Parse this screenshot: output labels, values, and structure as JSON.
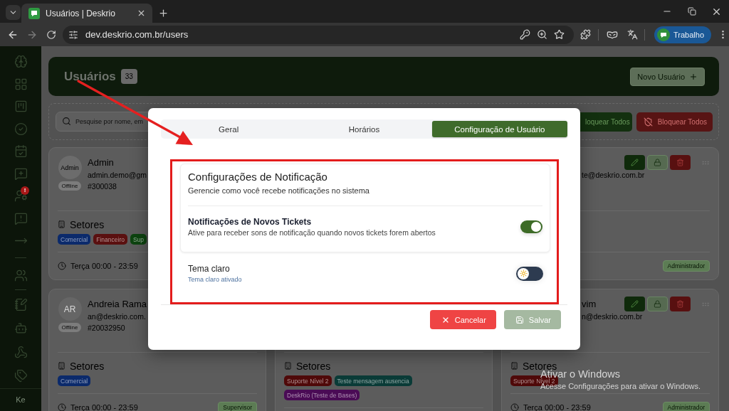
{
  "browser": {
    "tabs": [
      {
        "title": "Usuários | Deskrio",
        "selected": true
      }
    ],
    "url": "dev.deskrio.com.br/users",
    "profile_name": "Trabalho"
  },
  "sidebar": {
    "alert_badge": "!",
    "user_initials": "Ke"
  },
  "header": {
    "title": "Usuários",
    "count": "33",
    "new_user_button": "Novo Usuário"
  },
  "filters": {
    "search_placeholder": "Pesquise por nome, em",
    "buttons": [
      {
        "label": "loquear Todos",
        "kind": "unblock"
      },
      {
        "label": "Bloquear Todos",
        "kind": "block"
      }
    ]
  },
  "user_cards": [
    {
      "avatar": {
        "kind": "image",
        "text": "Admin"
      },
      "status": "Offline",
      "name": "Admin",
      "email": "admin.demo@gm",
      "code": "#300038",
      "sectors_title": "Setores",
      "sectors": [
        {
          "label": "Comercial",
          "color": "#0b2a6b"
        },
        {
          "label": "Financeiro",
          "color": "#5a1010"
        },
        {
          "label": "Sup",
          "color": "#0d4410"
        }
      ],
      "schedule": "Terça 00:00 - 23:59"
    },
    {
      "actions": [
        {
          "kind": "edit"
        },
        {
          "kind": "lock"
        },
        {
          "kind": "delete"
        }
      ],
      "email": "te@deskrio.com.br",
      "role": "Administrador"
    },
    {
      "avatar": {
        "kind": "initials",
        "text": "AR"
      },
      "status": "Offline",
      "name": "Andreia Rama",
      "email": "an@deskrio.com.",
      "code": "#20032950",
      "sectors_title": "Setores",
      "sectors": [
        {
          "label": "Comercial",
          "color": "#0b2a6b"
        }
      ],
      "schedule": "Terça 00:00 - 23:59",
      "role": "Supervisor"
    },
    {
      "sectors_title": "Setores",
      "sectors": [
        {
          "label": "Suporte Nível 2",
          "color": "#4f0909"
        },
        {
          "label": "Teste mensagem ausencia",
          "color": "#0a3b37"
        },
        {
          "label": "DeskRio (Teste de Bases)",
          "color": "#4a0b55"
        }
      ]
    },
    {
      "actions": [
        {
          "kind": "edit"
        },
        {
          "kind": "lock"
        },
        {
          "kind": "delete"
        }
      ],
      "name": "vim",
      "email": "n@deskrio.com.br",
      "sectors_title": "Setores",
      "sectors": [
        {
          "label": "Suporte Nível 2",
          "color": "#4f0909"
        }
      ],
      "schedule": "Terça 00:00 - 23:59",
      "role": "Administrador"
    }
  ],
  "modal": {
    "tabs": [
      {
        "label": "Geral",
        "selected": false
      },
      {
        "label": "Horários",
        "selected": false
      },
      {
        "label": "Configuração de Usuário",
        "selected": true
      }
    ],
    "notification_card": {
      "title": "Configurações de Notificação",
      "subtitle": "Gerencie como você recebe notificações no sistema",
      "setting": {
        "label": "Notificações de Novos Tickets",
        "description": "Ative para receber sons de notificação quando novos tickets forem abertos",
        "on": true
      }
    },
    "theme_setting": {
      "label": "Tema claro",
      "description": "Tema claro ativado",
      "dark_mode": false
    },
    "buttons": [
      {
        "label": "Cancelar",
        "kind": "cancel",
        "disabled": false
      },
      {
        "label": "Salvar",
        "kind": "save",
        "disabled": true
      }
    ]
  },
  "system_notice": {
    "title": "Ativar o Windows",
    "message": "Acesse Configurações para ativar o Windows."
  }
}
